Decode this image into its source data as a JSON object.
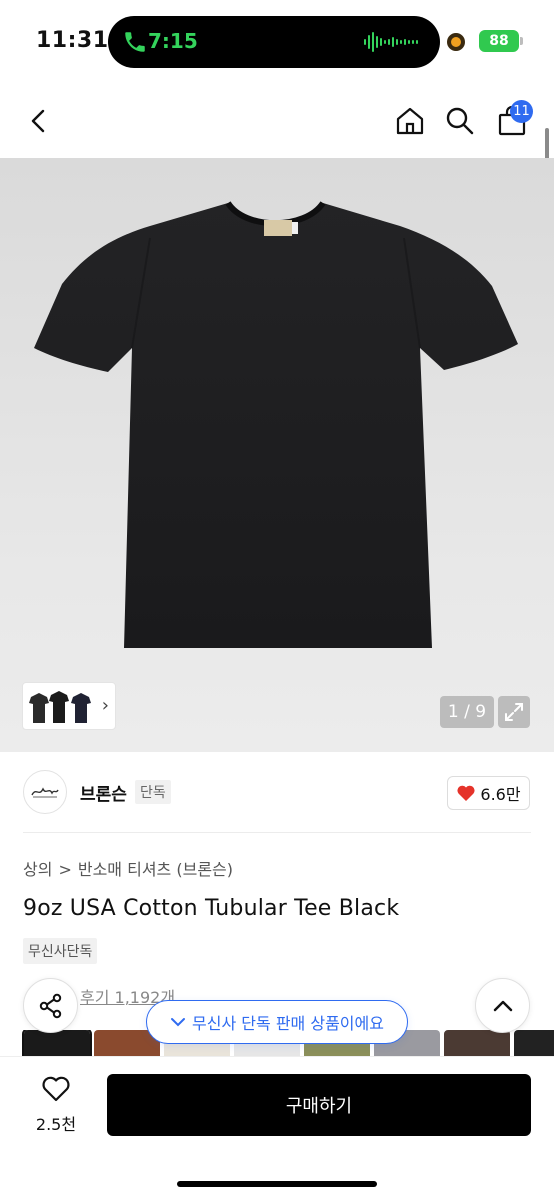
{
  "status_bar": {
    "time": "11:31",
    "call_time": "7:15",
    "battery": "88",
    "call_color": "#34d35c",
    "battery_color": "#30c94f"
  },
  "header": {
    "back_icon": "chevron-left-icon",
    "home_icon": "home-icon",
    "search_icon": "search-icon",
    "cart_icon": "shopping-bag-icon",
    "cart_count": "11",
    "accent": "#2f6bf0"
  },
  "gallery": {
    "counter": "1 / 9",
    "expand_icon": "expand-icon",
    "thumb_chevron": "›"
  },
  "brand": {
    "name": "브론슨",
    "tag": "단독",
    "likes": "6.6만",
    "heart_color": "#e5332a"
  },
  "breadcrumb": [
    "상의",
    "반소매 티셔츠 (브론슨)"
  ],
  "breadcrumb_sep": ">",
  "product": {
    "title": "9oz USA Cotton Tubular Tee Black",
    "exclusive_tag": "무신사단독",
    "review_link": "후기 1,192개"
  },
  "toast": {
    "label": "무신사 단독 판매 상품이에요"
  },
  "swatch_colors": [
    "#1a1a1a",
    "#8a4a2e",
    "#e9e4da",
    "#e6e6e6",
    "#8b8f5a",
    "#9a9aa0",
    "#4b3a33",
    "#222222"
  ],
  "bottom_bar": {
    "wish_count": "2.5천",
    "buy_label": "구매하기"
  }
}
